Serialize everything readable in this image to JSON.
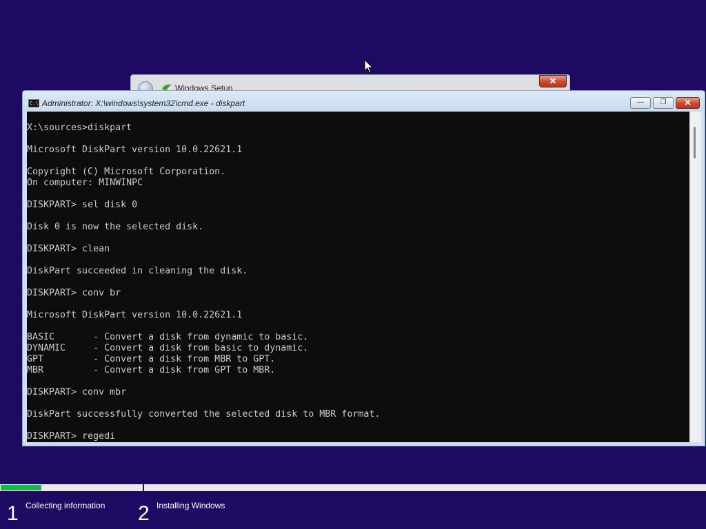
{
  "setup_window": {
    "title": "Windows Setup",
    "close_label": "✕"
  },
  "cmd_window": {
    "title": "Administrator: X:\\windows\\system32\\cmd.exe - diskpart",
    "icon_text": "C:\\",
    "buttons": {
      "minimize": "—",
      "maximize": "❐",
      "close": "✕"
    },
    "lines": [
      "X:\\sources>diskpart",
      "",
      "Microsoft DiskPart version 10.0.22621.1",
      "",
      "Copyright (C) Microsoft Corporation.",
      "On computer: MINWINPC",
      "",
      "DISKPART> sel disk 0",
      "",
      "Disk 0 is now the selected disk.",
      "",
      "DISKPART> clean",
      "",
      "DiskPart succeeded in cleaning the disk.",
      "",
      "DISKPART> conv br",
      "",
      "Microsoft DiskPart version 10.0.22621.1",
      "",
      "BASIC       - Convert a disk from dynamic to basic.",
      "DYNAMIC     - Convert a disk from basic to dynamic.",
      "GPT         - Convert a disk from MBR to GPT.",
      "MBR         - Convert a disk from GPT to MBR.",
      "",
      "DISKPART> conv mbr",
      "",
      "DiskPart successfully converted the selected disk to MBR format.",
      "",
      "DISKPART> regedi"
    ]
  },
  "progress": {
    "fraction": 0.058
  },
  "steps": [
    {
      "number": "1",
      "label": "Collecting information"
    },
    {
      "number": "2",
      "label": "Installing Windows"
    }
  ],
  "icons": {
    "cursor": "arrow-pointer-icon",
    "back": "back-arrow-icon",
    "setup": "windows-setup-icon",
    "cmd": "command-prompt-icon"
  },
  "colors": {
    "background": "#1e0a62",
    "console_background": "#0c0c0c",
    "console_text": "#cccccc",
    "progress": "#19b84d"
  }
}
